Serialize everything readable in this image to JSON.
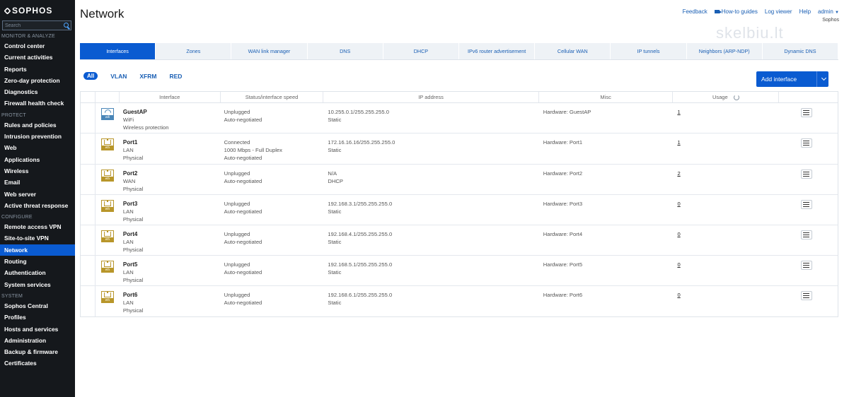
{
  "brand": {
    "logo_text": "SOPHOS"
  },
  "sidebar": {
    "search_placeholder": "Search",
    "sections": [
      {
        "label": "MONITOR & ANALYZE",
        "items": [
          "Control center",
          "Current activities",
          "Reports",
          "Zero-day protection",
          "Diagnostics",
          "Firewall health check"
        ]
      },
      {
        "label": "PROTECT",
        "items": [
          "Rules and policies",
          "Intrusion prevention",
          "Web",
          "Applications",
          "Wireless",
          "Email",
          "Web server",
          "Active threat response"
        ]
      },
      {
        "label": "CONFIGURE",
        "items": [
          "Remote access VPN",
          "Site-to-site VPN",
          "Network",
          "Routing",
          "Authentication",
          "System services"
        ]
      },
      {
        "label": "SYSTEM",
        "items": [
          "Sophos Central",
          "Profiles",
          "Hosts and services",
          "Administration",
          "Backup & firmware",
          "Certificates"
        ]
      }
    ],
    "active_item": "Network"
  },
  "header": {
    "title": "Network",
    "links": {
      "feedback": "Feedback",
      "howto": "How-to guides",
      "logviewer": "Log viewer",
      "help": "Help",
      "admin": "admin"
    },
    "tenant": "Sophos",
    "watermark": "skelbiu.lt"
  },
  "tabs": [
    "Interfaces",
    "Zones",
    "WAN link manager",
    "DNS",
    "DHCP",
    "IPv6 router advertisement",
    "Cellular WAN",
    "IP tunnels",
    "Neighbors (ARP-NDP)",
    "Dynamic DNS"
  ],
  "active_tab": "Interfaces",
  "filters": {
    "all": "All",
    "vlan": "VLAN",
    "xfrm": "XFRM",
    "red": "RED"
  },
  "add_button": "Add interface",
  "table": {
    "headers": {
      "interface": "Interface",
      "status": "Status/interface speed",
      "ip": "IP address",
      "misc": "Misc",
      "usage": "Usage"
    },
    "rows": [
      {
        "icon": "wifi",
        "icon_label": "wifi",
        "name": "GuestAP",
        "type": "WiFi",
        "sub": "Wireless protection",
        "status": [
          "Unplugged",
          "Auto-negotiated",
          ""
        ],
        "ip": "10.255.0.1/255.255.255.0",
        "ip_mode": "Static",
        "misc": "Hardware:  GuestAP",
        "usage": "1"
      },
      {
        "icon": "eth",
        "icon_label": "eth",
        "name": "Port1",
        "type": "LAN",
        "sub": "Physical",
        "status": [
          "Connected",
          "1000 Mbps - Full Duplex",
          "Auto-negotiated"
        ],
        "ip": "172.16.16.16/255.255.255.0",
        "ip_mode": "Static",
        "misc": "Hardware:  Port1",
        "usage": "1"
      },
      {
        "icon": "eth",
        "icon_label": "eth",
        "name": "Port2",
        "type": "WAN",
        "sub": "Physical",
        "status": [
          "Unplugged",
          "Auto-negotiated",
          ""
        ],
        "ip": "N/A",
        "ip_mode": "DHCP",
        "misc": "Hardware:  Port2",
        "usage": "2"
      },
      {
        "icon": "eth",
        "icon_label": "eth",
        "name": "Port3",
        "type": "LAN",
        "sub": "Physical",
        "status": [
          "Unplugged",
          "Auto-negotiated",
          ""
        ],
        "ip": "192.168.3.1/255.255.255.0",
        "ip_mode": "Static",
        "misc": "Hardware:  Port3",
        "usage": "0"
      },
      {
        "icon": "eth",
        "icon_label": "eth",
        "name": "Port4",
        "type": "LAN",
        "sub": "Physical",
        "status": [
          "Unplugged",
          "Auto-negotiated",
          ""
        ],
        "ip": "192.168.4.1/255.255.255.0",
        "ip_mode": "Static",
        "misc": "Hardware:  Port4",
        "usage": "0"
      },
      {
        "icon": "eth",
        "icon_label": "eth",
        "name": "Port5",
        "type": "LAN",
        "sub": "Physical",
        "status": [
          "Unplugged",
          "Auto-negotiated",
          ""
        ],
        "ip": "192.168.5.1/255.255.255.0",
        "ip_mode": "Static",
        "misc": "Hardware:  Port5",
        "usage": "0"
      },
      {
        "icon": "eth",
        "icon_label": "eth",
        "name": "Port6",
        "type": "LAN",
        "sub": "Physical",
        "status": [
          "Unplugged",
          "Auto-negotiated",
          ""
        ],
        "ip": "192.168.6.1/255.255.255.0",
        "ip_mode": "Static",
        "misc": "Hardware:  Port6",
        "usage": "0"
      }
    ]
  },
  "colors": {
    "accent": "#0a5bd1",
    "sidebar_bg": "#15181c",
    "eth_icon": "#b8962a",
    "wifi_icon": "#4a86b8"
  }
}
